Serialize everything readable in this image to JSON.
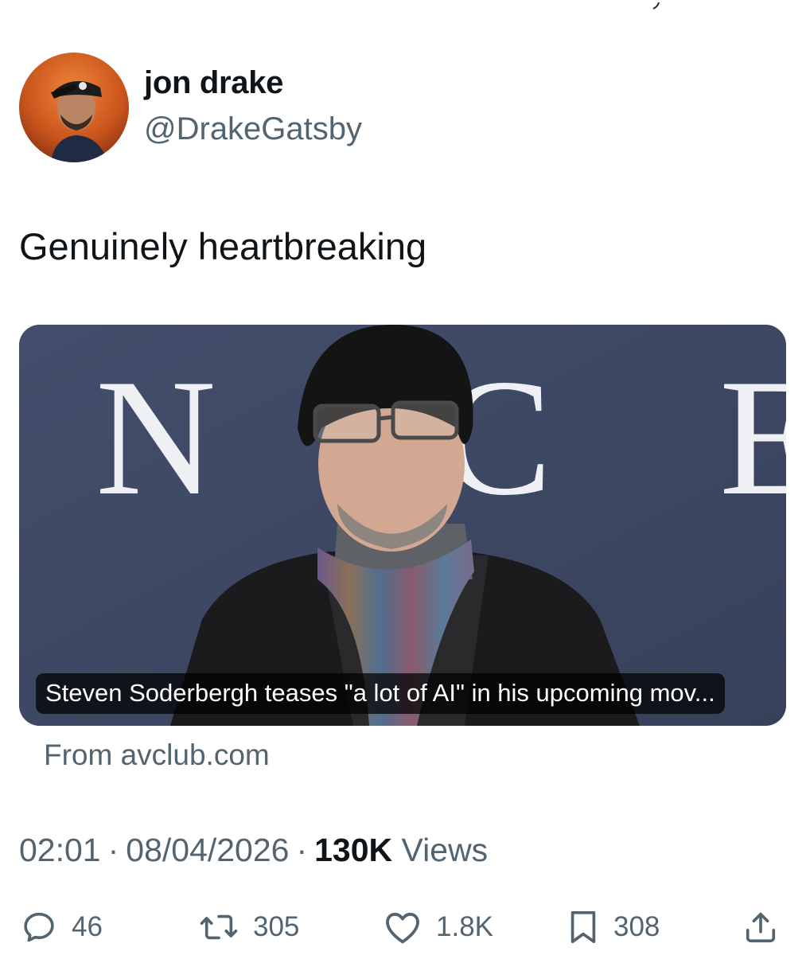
{
  "author": {
    "display_name": "jon drake",
    "handle": "@DrakeGatsby"
  },
  "tweet": {
    "text": "Genuinely heartbreaking"
  },
  "link_card": {
    "title": "Steven Soderbergh teases \"a lot of AI\" in his upcoming mov...",
    "source": "From avclub.com",
    "image_backdrop_letters": [
      "N",
      "C",
      "E"
    ]
  },
  "meta": {
    "time": "02:01",
    "separator": "·",
    "date": "08/04/2026",
    "views_count": "130K",
    "views_label": "Views"
  },
  "actions": {
    "reply_count": "46",
    "retweet_count": "305",
    "like_count": "1.8K",
    "bookmark_count": "308"
  },
  "icons": {
    "reply": "reply-icon",
    "retweet": "retweet-icon",
    "like": "heart-icon",
    "bookmark": "bookmark-icon",
    "share": "share-icon"
  },
  "colors": {
    "text_primary": "#0f1419",
    "text_secondary": "#536471",
    "card_backdrop": "#3f4a66"
  }
}
